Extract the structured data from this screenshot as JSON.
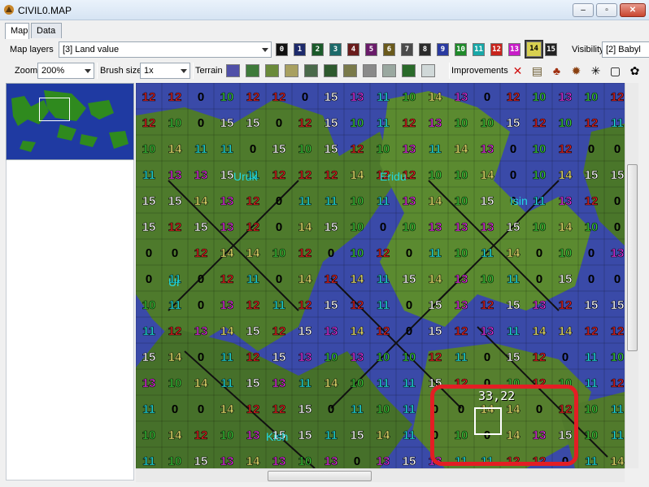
{
  "window": {
    "title": "CIVIL0.MAP",
    "min": "–",
    "max": "▫",
    "close": "✕"
  },
  "tabs": [
    {
      "label": "Map",
      "active": true
    },
    {
      "label": "Data",
      "active": false
    }
  ],
  "toolbar1": {
    "map_layers_label": "Map layers",
    "map_layers_value": "[3] Land value",
    "land_value_buttons": [
      {
        "label": "0",
        "color": "#111111"
      },
      {
        "label": "1",
        "color": "#1d2a6b"
      },
      {
        "label": "2",
        "color": "#1b5a2a"
      },
      {
        "label": "3",
        "color": "#1c6a6a"
      },
      {
        "label": "4",
        "color": "#6a1c1c"
      },
      {
        "label": "5",
        "color": "#6a1c6a"
      },
      {
        "label": "6",
        "color": "#6a5a1c"
      },
      {
        "label": "7",
        "color": "#4a4a4a"
      },
      {
        "label": "8",
        "color": "#2a2a2a"
      },
      {
        "label": "9",
        "color": "#2a3aa0"
      },
      {
        "label": "10",
        "color": "#1f8a2a"
      },
      {
        "label": "11",
        "color": "#18a8a8"
      },
      {
        "label": "12",
        "color": "#c8241c"
      },
      {
        "label": "13",
        "color": "#c81cc8"
      },
      {
        "label": "14",
        "color": "#d8d050",
        "selected": true
      },
      {
        "label": "15",
        "color": "#222222"
      }
    ],
    "visibility_label": "Visibility",
    "visibility_value": "[2] Babyl"
  },
  "toolbar2": {
    "zoom_label": "Zoom",
    "zoom_value": "200%",
    "brush_label": "Brush size",
    "brush_value": "1x",
    "terrain_label": "Terrain",
    "terrain_swatches": [
      {
        "name": "ocean",
        "color": "#5050a8"
      },
      {
        "name": "grassland",
        "color": "#3e7a3a"
      },
      {
        "name": "plains",
        "color": "#6a8a3a"
      },
      {
        "name": "desert",
        "color": "#a8a060"
      },
      {
        "name": "swamp",
        "color": "#4a6a4a"
      },
      {
        "name": "forest",
        "color": "#2e5a2e"
      },
      {
        "name": "hills",
        "color": "#7a7a4a"
      },
      {
        "name": "mountains",
        "color": "#8a8a8a"
      },
      {
        "name": "tundra",
        "color": "#9aa8a0"
      },
      {
        "name": "jungle",
        "color": "#2a6a2a"
      },
      {
        "name": "arctic",
        "color": "#d0d8d8"
      }
    ],
    "improvements_label": "Improvements",
    "improvements": [
      {
        "name": "clear-icon",
        "glyph": "✕",
        "color": "#d01010"
      },
      {
        "name": "road-icon",
        "glyph": "▤",
        "color": "#6a5a30"
      },
      {
        "name": "irrigation-icon",
        "glyph": "♣",
        "color": "#a03010"
      },
      {
        "name": "mine-icon",
        "glyph": "✹",
        "color": "#8a4010"
      },
      {
        "name": "railroad-icon",
        "glyph": "✳",
        "color": "#000000"
      },
      {
        "name": "fortress-icon",
        "glyph": "▢",
        "color": "#000000"
      },
      {
        "name": "pollution-icon",
        "glyph": "✿",
        "color": "#000000"
      }
    ]
  },
  "map": {
    "cursor_coords": "33,22",
    "city_labels": [
      "Uruk",
      "Eridu",
      "Isin",
      "Kish",
      "Ur"
    ],
    "land_values": [
      "0",
      "10",
      "11",
      "12",
      "13",
      "14",
      "15"
    ]
  },
  "scroll": {
    "h_grip": "|||",
    "v_grip": "="
  }
}
